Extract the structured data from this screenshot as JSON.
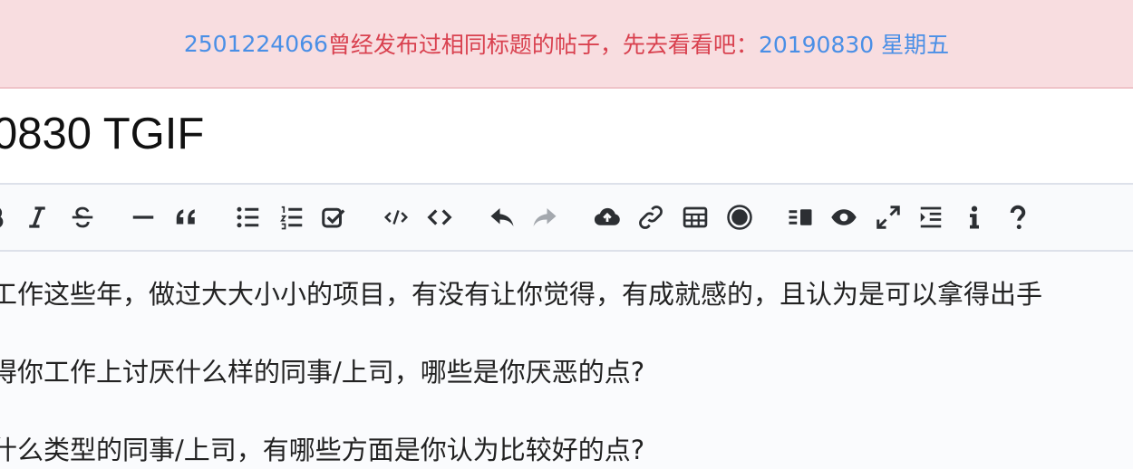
{
  "alert": {
    "user_link": "2501224066",
    "message": " 曾经发布过相同标题的帖子，先去看看吧：",
    "post_link": "20190830 星期五"
  },
  "title_input": {
    "value": "0830 TGIF"
  },
  "editor": {
    "lines": [
      "工作这些年，做过大大小小的项目，有没有让你觉得，有成就感的，且认为是可以拿得出手",
      "得你工作上讨厌什么样的同事/上司，哪些是你厌恶的点?",
      "什么类型的同事/上司，有哪些方面是你认为比较好的点?"
    ]
  },
  "toolbar": {
    "buttons": [
      "bold-icon",
      "italic-icon",
      "strikethrough-icon",
      "horizontal-rule-icon",
      "quote-icon",
      "unordered-list-icon",
      "ordered-list-icon",
      "checklist-icon",
      "inline-code-icon",
      "code-block-icon",
      "undo-icon",
      "redo-icon",
      "upload-icon",
      "link-icon",
      "table-icon",
      "record-icon",
      "split-view-icon",
      "preview-icon",
      "fullscreen-icon",
      "outline-icon",
      "info-icon",
      "help-icon"
    ]
  },
  "colors": {
    "alert_bg": "#f8dde0",
    "alert_text": "#d9414f",
    "link": "#4a8fe6",
    "toolbar_bg": "#f9fafc"
  }
}
